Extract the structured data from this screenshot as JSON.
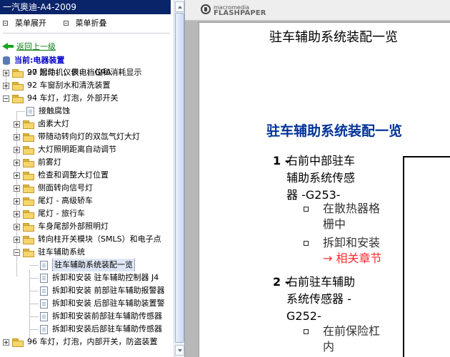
{
  "left_panel": {
    "title": "一汽奥迪-A4-2009",
    "menu_expand": "菜单展开",
    "menu_collapse": "菜单折叠",
    "back": "返回上一级",
    "current": "当前:电器装置",
    "tree": [
      {
        "type": "folder",
        "expanded": false,
        "label": "27 起动机，供电，GRA"
      },
      {
        "type": "folder",
        "expanded": false,
        "label": "90 附件，仪表，档位和消耗显示"
      },
      {
        "type": "folder",
        "expanded": false,
        "label": "92 车窗刮水和清洗装置"
      },
      {
        "type": "folder",
        "expanded": true,
        "label": "94 车灯，灯泡，外部开关"
      },
      {
        "type": "doc",
        "label": "接触腐蚀"
      },
      {
        "type": "folder",
        "expanded": false,
        "label": "卤素大灯"
      },
      {
        "type": "folder",
        "expanded": false,
        "label": "带随动转向灯的双氙气灯大灯"
      },
      {
        "type": "folder",
        "expanded": false,
        "label": "大灯照明距离自动调节"
      },
      {
        "type": "folder",
        "expanded": false,
        "label": "前雾灯"
      },
      {
        "type": "folder",
        "expanded": false,
        "label": "检查和调整大灯位置"
      },
      {
        "type": "folder",
        "expanded": false,
        "label": "侧面转向信号灯"
      },
      {
        "type": "folder",
        "expanded": false,
        "label": "尾灯 - 高级轿车"
      },
      {
        "type": "folder",
        "expanded": false,
        "label": "尾灯 - 旅行车"
      },
      {
        "type": "folder",
        "expanded": false,
        "label": "车身尾部外部照明灯"
      },
      {
        "type": "folder",
        "expanded": false,
        "label": "转向柱开关模块（SMLS）和电子点"
      },
      {
        "type": "folder",
        "expanded": true,
        "label": "驻车辅助系统"
      },
      {
        "type": "doc",
        "selected": true,
        "label": "驻车辅助系统装配一览"
      },
      {
        "type": "doc",
        "label": "拆卸和安装 驻车辅助控制器 J4"
      },
      {
        "type": "doc",
        "label": "拆卸和安装 前部驻车辅助报警器"
      },
      {
        "type": "doc",
        "label": "拆卸和安装 后部驻车辅助装置警"
      },
      {
        "type": "doc",
        "label": "拆卸和安装前部驻车辅助传感器"
      },
      {
        "type": "doc",
        "label": "拆卸和安装后部驻车辅助传感器"
      },
      {
        "type": "folder",
        "expanded": false,
        "label": "96 车灯，灯泡，内部开关，防盗装置"
      }
    ]
  },
  "right_panel": {
    "brand_top": "macromedia",
    "brand_bottom": "FLASHPAPER",
    "doc_title": "驻车辅助系统装配一览",
    "section_title": "驻车辅助系统装配一览",
    "items": [
      {
        "num": "1 -",
        "lines": [
          "右前中部驻车",
          "辅助系统传感",
          "器 -G253-"
        ]
      },
      {
        "num": "2 -",
        "lines": [
          "右前驻车辅助",
          "系统传感器 -",
          "G252-"
        ]
      }
    ],
    "details": [
      {
        "lines": [
          "在散热器格",
          "栅中"
        ]
      },
      {
        "lines": [
          "拆卸和安装"
        ],
        "link": "→ 相关章节"
      },
      {
        "lines": [
          "在前保险杠",
          "内"
        ]
      }
    ]
  }
}
